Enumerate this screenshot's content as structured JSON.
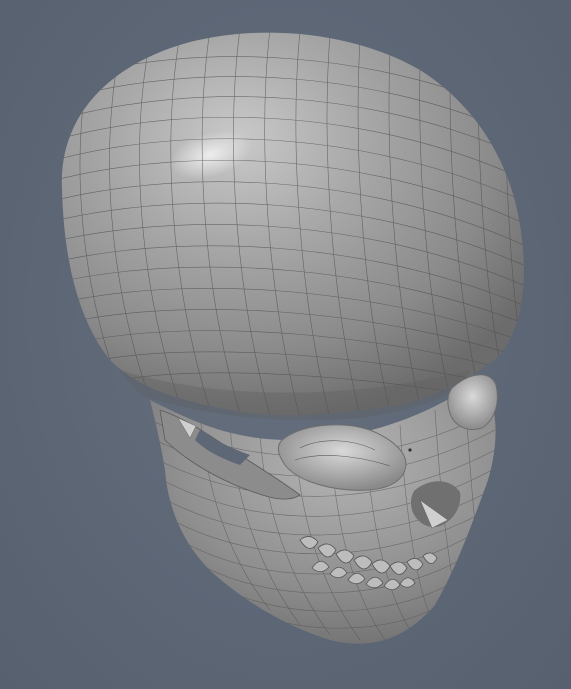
{
  "viewport": {
    "background_color": "#5d6776",
    "subject": "skull-wireframe-model",
    "shading": "gray-matcap",
    "mesh_color": "#4e4e4e"
  }
}
